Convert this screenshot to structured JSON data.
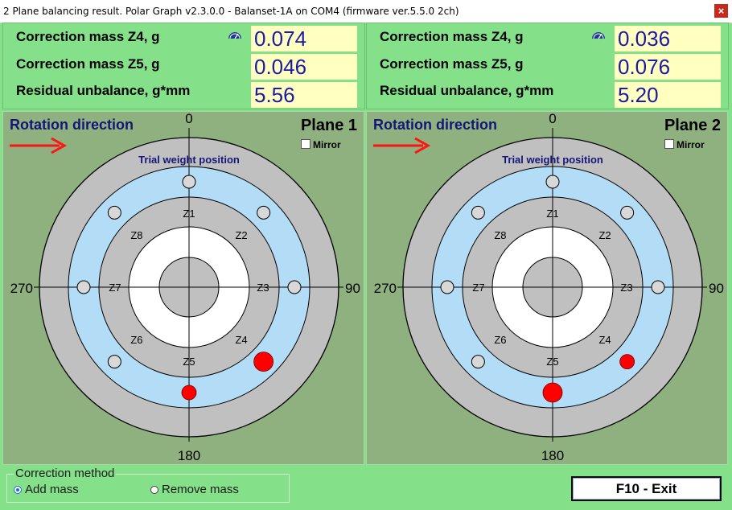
{
  "window": {
    "title": "2 Plane balancing result. Polar Graph v2.3.0.0 - Balanset-1A on COM4 (firmware ver.5.5.0 2ch)",
    "close_glyph": "×"
  },
  "colors": {
    "background": "#85e08a",
    "value_bg": "#ffffc0",
    "value_text": "#1a1aa6",
    "rotation_text": "#16167a",
    "arrow": "#ff1414",
    "disc_gray": "#c0c0c0",
    "disc_blue": "#b3dcf7",
    "correction_mass": "#ff0000"
  },
  "labels": {
    "correction_z4": "Correction mass Z4, g",
    "correction_z5": "Correction mass Z5, g",
    "residual": "Residual unbalance, g*mm",
    "rotation_direction": "Rotation direction",
    "mirror": "Mirror",
    "trial_weight_position": "Trial weight position",
    "angle_top": "0",
    "angle_right": "90",
    "angle_bottom": "180",
    "angle_left": "270",
    "zones": [
      "Z1",
      "Z2",
      "Z3",
      "Z4",
      "Z5",
      "Z6",
      "Z7",
      "Z8"
    ]
  },
  "planes": [
    {
      "name": "Plane 1",
      "correction_z4": "0.074",
      "correction_z5": "0.046",
      "residual": "5.56",
      "mirror_checked": false,
      "mass_z4": "large",
      "mass_z5": "small"
    },
    {
      "name": "Plane 2",
      "correction_z4": "0.036",
      "correction_z5": "0.076",
      "residual": "5.20",
      "mirror_checked": false,
      "mass_z4": "small",
      "mass_z5": "large"
    }
  ],
  "correction_method": {
    "legend": "Correction method",
    "add_mass": "Add mass",
    "remove_mass": "Remove mass",
    "selected": "add_mass"
  },
  "exit_button": "F10 - Exit"
}
